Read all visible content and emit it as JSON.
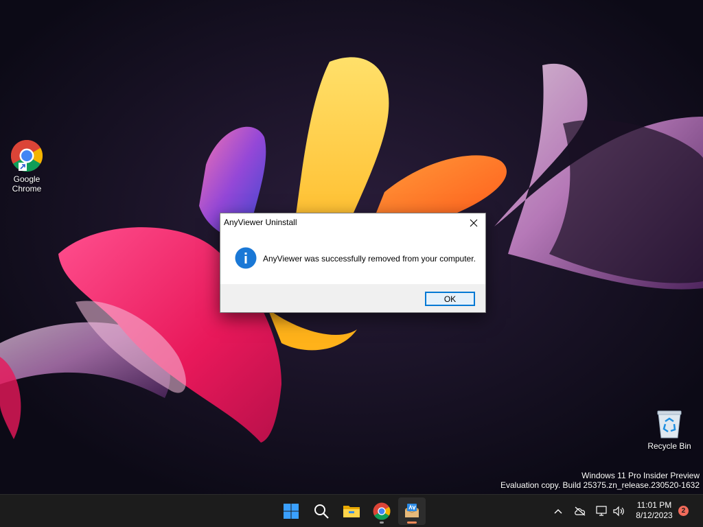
{
  "desktop": {
    "icons": [
      {
        "label": "Google\nChrome"
      },
      {
        "label": "Recycle Bin"
      }
    ],
    "watermark": {
      "line1": "Windows 11 Pro Insider Preview",
      "line2": "Evaluation copy. Build 25375.zn_release.230520-1632"
    }
  },
  "dialog": {
    "title": "AnyViewer Uninstall",
    "message": "AnyViewer was successfully removed from your computer.",
    "ok_label": "OK",
    "icon": "info-icon"
  },
  "taskbar": {
    "apps": [
      {
        "name": "start-icon"
      },
      {
        "name": "search-icon"
      },
      {
        "name": "file-explorer-icon"
      },
      {
        "name": "chrome-icon"
      },
      {
        "name": "anyviewer-icon",
        "active": true
      }
    ],
    "tray": {
      "icons": [
        "chevron-up-icon",
        "cloud-offline-icon",
        "network-icon",
        "volume-icon"
      ],
      "time": "11:01 PM",
      "date": "8/12/2023",
      "notification_count": "2"
    }
  },
  "colors": {
    "accent": "#0078d4",
    "taskbar": "#1c1c1c",
    "desktop_bg": "#0e0b1a",
    "notification": "#f26b5b"
  }
}
